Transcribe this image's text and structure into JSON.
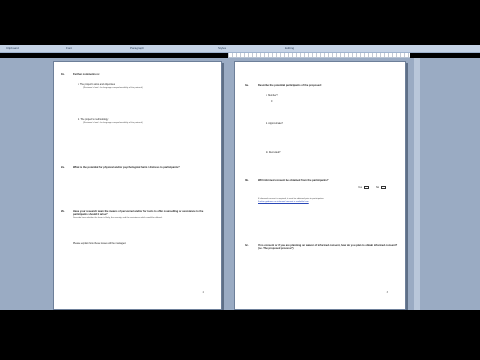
{
  "ribbon": {
    "groups": [
      "Clipboard",
      "Font",
      "Paragraph",
      "Styles",
      "Editing"
    ]
  },
  "left_page": {
    "section_1": {
      "num": "1b.",
      "title": "Further comments re:",
      "item_i_label": "i.   The project's aims and objectives",
      "item_i_note": "(Reviewer's lead - for language comprehensibility of the protocol)",
      "item_ii_label": "ii.   The project's methodology",
      "item_ii_note": "(Reviewer's lead - for language comprehensibility of the protocol)"
    },
    "section_2": {
      "num": "2a.",
      "title": "What is the potential for physical and/or psychological harm / distress to participants?"
    },
    "section_3": {
      "num": "2b.",
      "title": "Have your research team the means of personnel and/or for tools to offer counselling or assistance to the participants should it arise?",
      "note": "Describe here whether the harm is likely, the severity, and the assistance which would be offered."
    },
    "section_4": {
      "note": "Please explain how these issues will be managed."
    },
    "page_number": "2"
  },
  "right_page": {
    "section_1": {
      "num": "3a.",
      "title": "Describe the potential participants of the proposed:",
      "item_i": "i.   Number?",
      "item_i_value": "0",
      "item_ii": "ii.   Approximate?",
      "item_iii": "iii.   Recruited?"
    },
    "section_2": {
      "num": "3b.",
      "title": "Will informed consent be obtained from the participants?",
      "yes_label": "Yes",
      "no_label": "No",
      "note": "If informed consent is required, it must be obtained prior to participation.",
      "link": "Further guidance on informed consent is available here"
    },
    "section_3": {
      "num": "3c.",
      "title": "If no consent or if you are planning on waiver of informed consent, how do you plan to obtain informed consent? (i.e. The proposed process?)"
    },
    "page_number": "3"
  }
}
